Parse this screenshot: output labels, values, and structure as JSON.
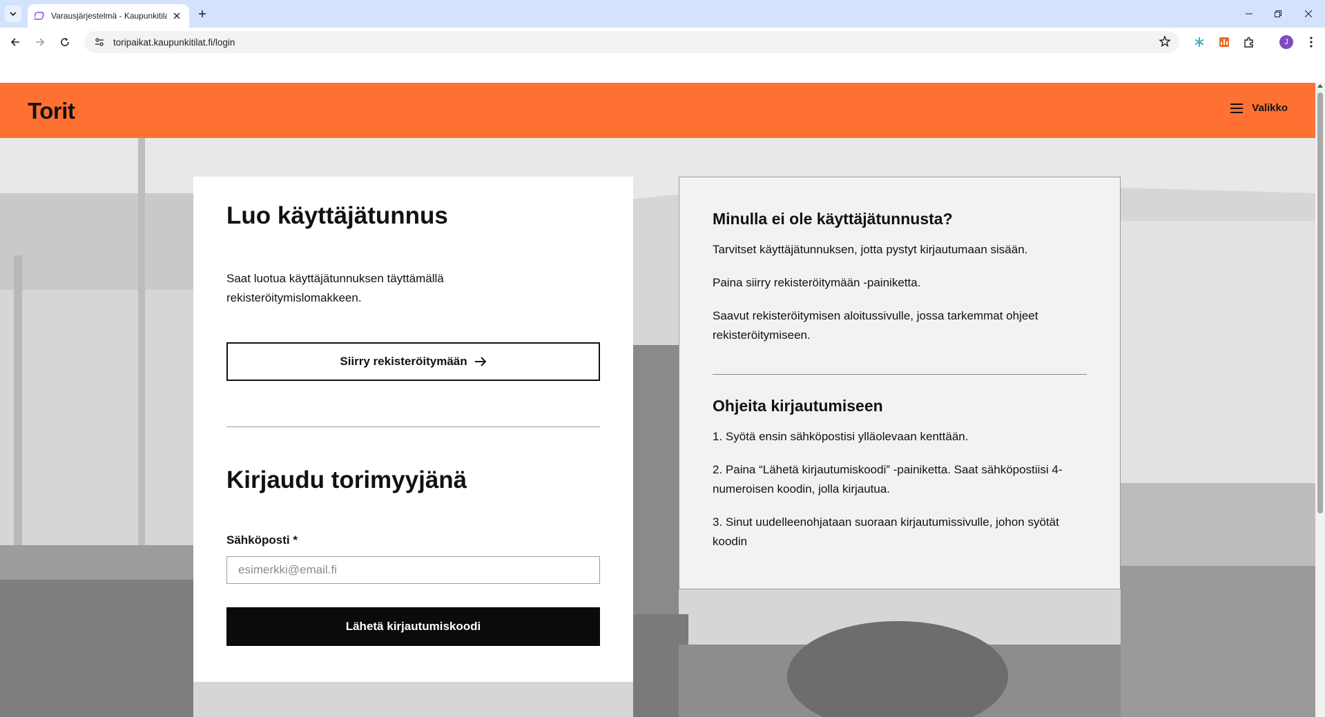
{
  "browser": {
    "tab_title": "Varausjärjestelmä - Kaupunkitilat",
    "url": "toripaikat.kaupunkitilat.fi/login",
    "profile_initial": "J"
  },
  "header": {
    "logo": "Torit",
    "menu_label": "Valikko"
  },
  "register": {
    "title": "Luo käyttäjätunnus",
    "intro": "Saat luotua käyttäjätunnuksen täyttämällä rekisteröitymislomakkeen.",
    "button_label": "Siirry rekisteröitymään"
  },
  "login": {
    "title": "Kirjaudu torimyyjänä",
    "email_label": "Sähköposti *",
    "email_placeholder": "esimerkki@email.fi",
    "email_value": "",
    "submit_label": "Lähetä kirjautumiskoodi"
  },
  "info": {
    "no_account_title": "Minulla ei ole käyttäjätunnusta?",
    "no_account_p1": "Tarvitset käyttäjätunnuksen, jotta pystyt kirjautumaan sisään.",
    "no_account_p2": "Paina siirry rekisteröitymään -painiketta.",
    "no_account_p3": "Saavut rekisteröitymisen aloitussivulle, jossa tarkemmat ohjeet rekisteröitymiseen.",
    "instructions_title": "Ohjeita kirjautumiseen",
    "step1": "1. Syötä ensin sähköpostisi ylläolevaan kenttään.",
    "step2": "2. Paina “Lähetä kirjautumiskoodi” -painiketta. Saat sähköpostiisi 4-numeroisen koodin, jolla kirjautua.",
    "step3": "3. Sinut uudelleenohjataan suoraan kirjautumissivulle, johon syötät koodin"
  },
  "colors": {
    "brand_orange": "#ff7132",
    "primary_button": "#0b0b0b",
    "info_card_bg": "#f2f2f2"
  }
}
